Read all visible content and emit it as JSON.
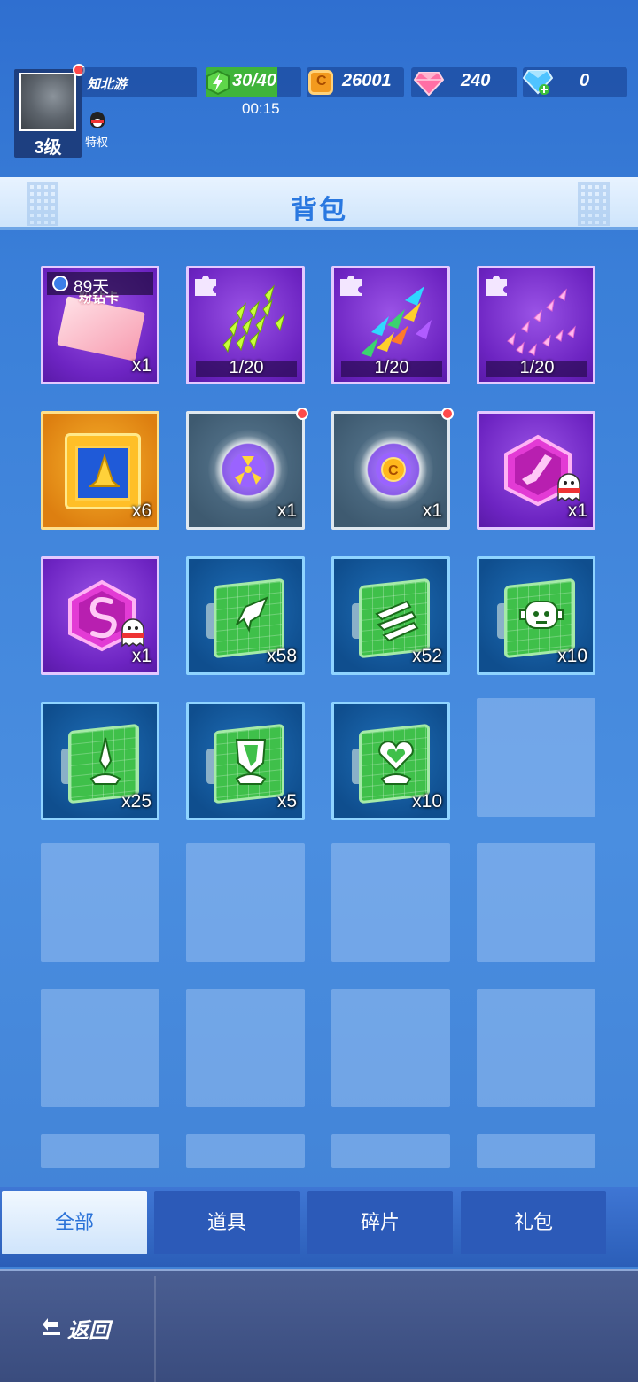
{
  "player": {
    "name": "知北游",
    "level": "3级",
    "privilege": "特权"
  },
  "resources": {
    "energy": "30/40",
    "energy_fill": 0.75,
    "timer": "00:15",
    "coins": "26001",
    "pink_gems": "240",
    "diamonds": "0"
  },
  "title": "背包",
  "items": [
    {
      "kind": "card",
      "timer": "89天",
      "card_text": "粉钻卡",
      "count": "x1"
    },
    {
      "kind": "fragment",
      "progress": "1/20"
    },
    {
      "kind": "fragment",
      "progress": "1/20"
    },
    {
      "kind": "fragment",
      "progress": "1/20"
    },
    {
      "kind": "gold-box",
      "count": "x6"
    },
    {
      "kind": "radar",
      "count": "x1",
      "badge": true
    },
    {
      "kind": "radar-coin",
      "count": "x1",
      "badge": true
    },
    {
      "kind": "hex-rocket",
      "count": "x1"
    },
    {
      "kind": "hex-s",
      "count": "x1"
    },
    {
      "kind": "screen-rocket",
      "count": "x58"
    },
    {
      "kind": "screen-arrows",
      "count": "x52"
    },
    {
      "kind": "screen-robot",
      "count": "x10"
    },
    {
      "kind": "screen-sword",
      "count": "x25"
    },
    {
      "kind": "screen-shield",
      "count": "x5"
    },
    {
      "kind": "screen-heart",
      "count": "x10"
    }
  ],
  "tabs": [
    "全部",
    "道具",
    "碎片",
    "礼包"
  ],
  "back_label": "返回",
  "colors": {
    "accent": "#2a78e0",
    "energy": "#3fb43a",
    "coin": "#f39a1e",
    "pink_gem": "#ff6fa5",
    "diamond": "#4fc3ff",
    "badge": "#ff4a4a"
  }
}
